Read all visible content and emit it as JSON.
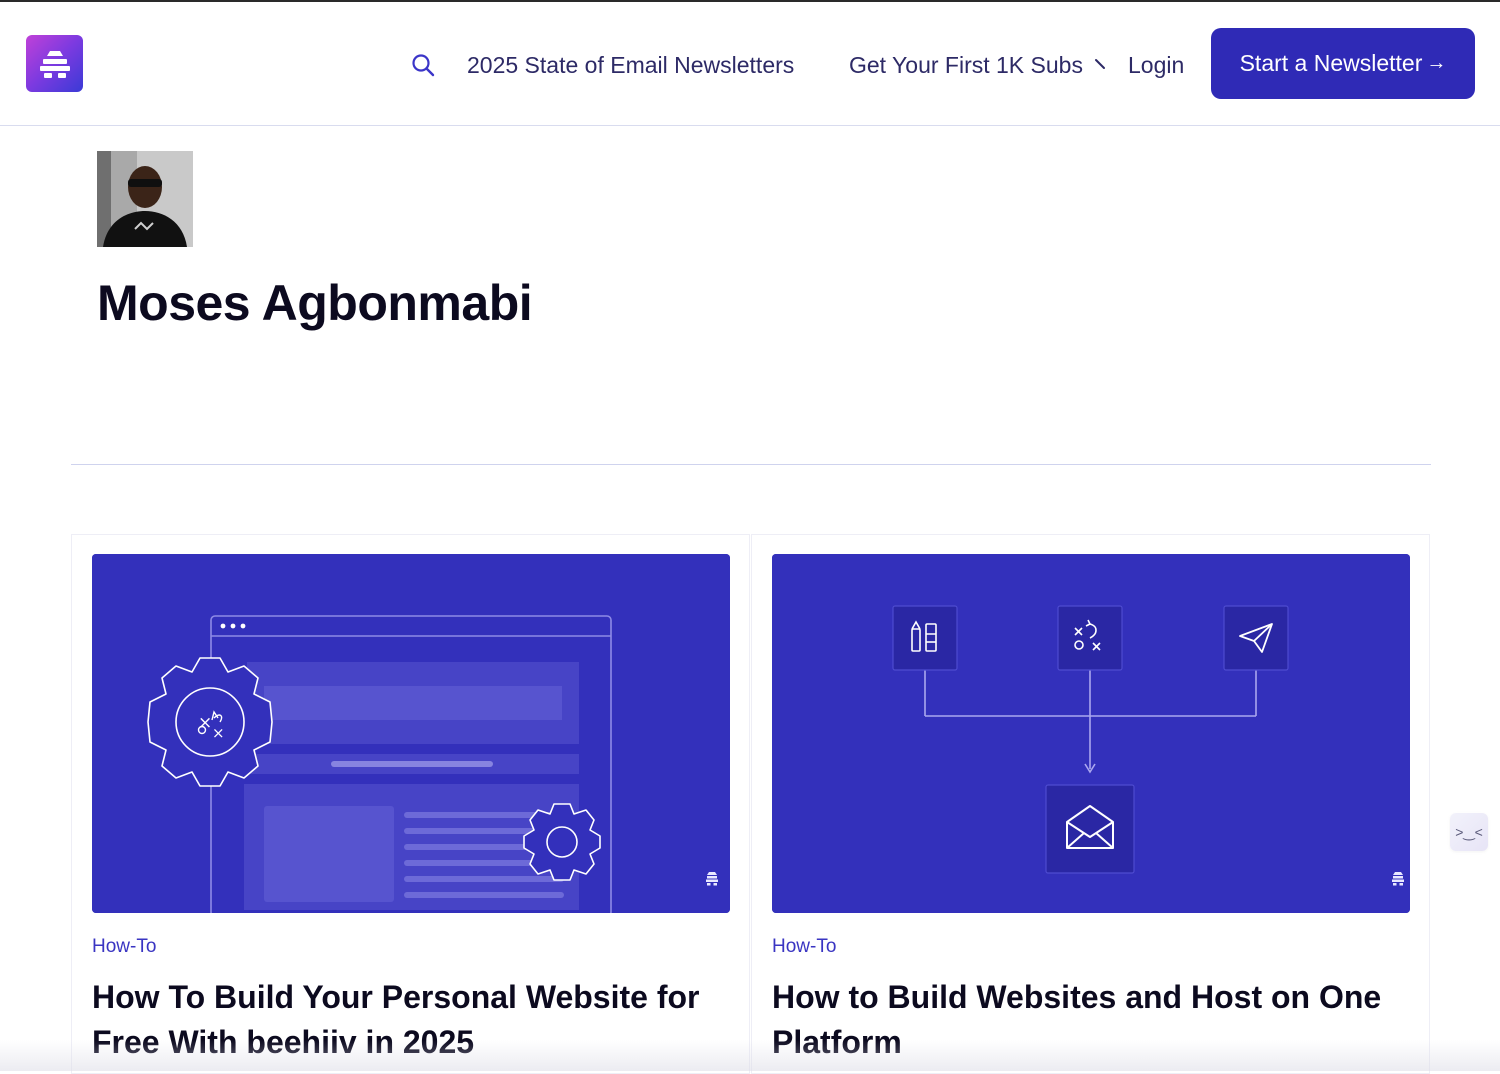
{
  "header": {
    "nav": [
      {
        "label": "2025 State of Email Newsletters"
      },
      {
        "label": "Get Your First 1K Subs"
      },
      {
        "label": "Login"
      }
    ],
    "cta_label": "Start a Newsletter",
    "cta_arrow": "→"
  },
  "author": {
    "name": "Moses Agbonmabi"
  },
  "posts": [
    {
      "category": "How-To",
      "title": "How To Build Your Personal Website for Free With beehiiv in 2025"
    },
    {
      "category": "How-To",
      "title": "How to Build Websites and Host on One Platform"
    }
  ],
  "side_widget": {
    "glyph": ">‿<"
  },
  "colors": {
    "brand": "#2f2ab6",
    "card_image_bg": "#3330bb",
    "nav_text": "#2d2a66"
  },
  "icons": [
    "beehiiv-logo-icon",
    "search-icon",
    "chevron-down-icon",
    "arrow-right-icon",
    "envelope-icon",
    "paper-plane-icon",
    "gear-icon"
  ]
}
